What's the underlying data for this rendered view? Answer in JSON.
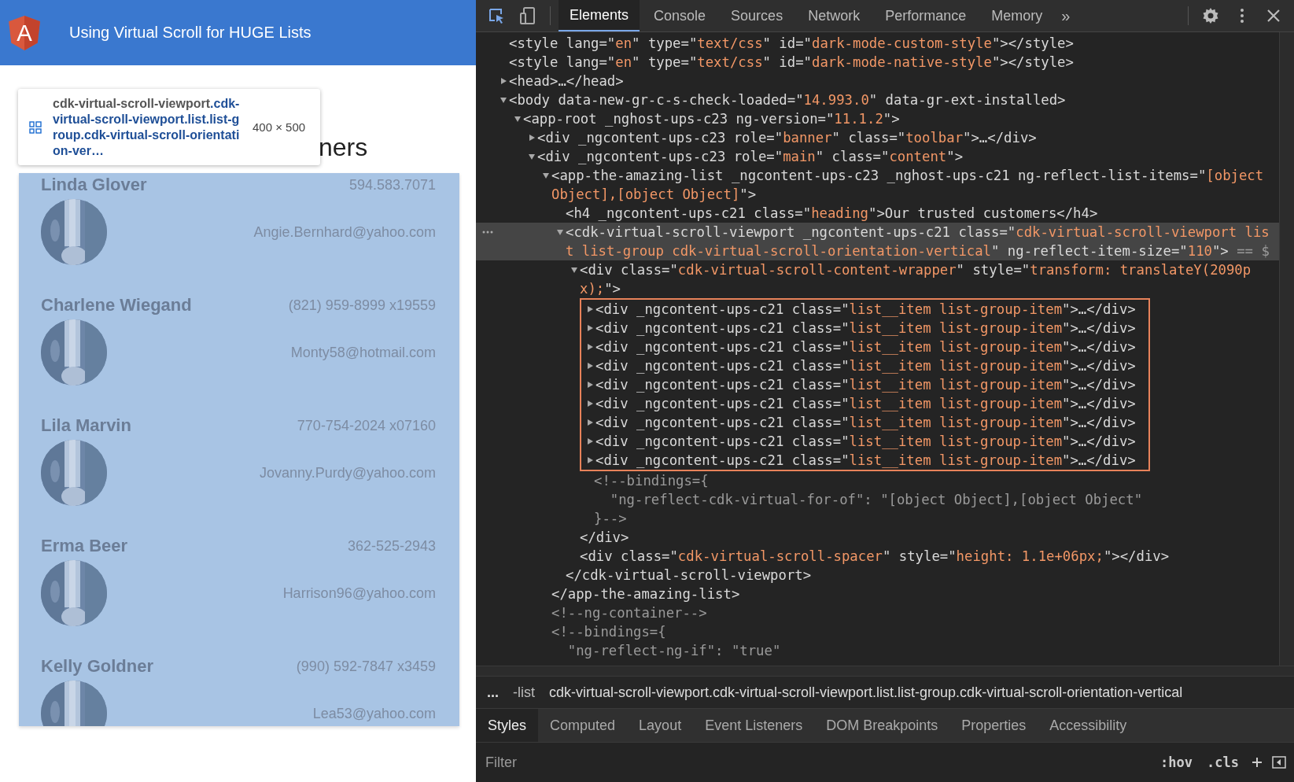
{
  "app": {
    "logo_letter": "A",
    "title": "Using Virtual Scroll for HUGE Lists",
    "heading": "ners",
    "tooltip": {
      "tag": "cdk-virtual-scroll-viewport",
      "classes": ".cdk-virtual-scroll-viewport.list.list-group.cdk-virtual-scroll-orientation-ver…",
      "size": "400 × 500"
    },
    "customers": [
      {
        "name": "Linda Glover",
        "phone": "594.583.7071",
        "email": "Angie.Bernhard@yahoo.com"
      },
      {
        "name": "Charlene Wiegand",
        "phone": "(821) 959-8999 x19559",
        "email": "Monty58@hotmail.com"
      },
      {
        "name": "Lila Marvin",
        "phone": "770-754-2024 x07160",
        "email": "Jovanny.Purdy@yahoo.com"
      },
      {
        "name": "Erma Beer",
        "phone": "362-525-2943",
        "email": "Harrison96@yahoo.com"
      },
      {
        "name": "Kelly Goldner",
        "phone": "(990) 592-7847 x3459",
        "email": "Lea53@yahoo.com"
      }
    ]
  },
  "devtools": {
    "tabs": [
      {
        "label": "Elements",
        "selected": true
      },
      {
        "label": "Console",
        "selected": false
      },
      {
        "label": "Sources",
        "selected": false
      },
      {
        "label": "Network",
        "selected": false
      },
      {
        "label": "Performance",
        "selected": false
      },
      {
        "label": "Memory",
        "selected": false
      }
    ],
    "more_tabs": "»",
    "dom": [
      {
        "kind": "node",
        "selected": false,
        "parts": [
          {
            "kind": "markup",
            "text": "<style lang=\""
          },
          {
            "kind": "value",
            "text": "en"
          },
          {
            "kind": "markup",
            "text": "\" type=\""
          },
          {
            "kind": "value",
            "text": "text/css"
          },
          {
            "kind": "markup",
            "text": "\" id=\""
          },
          {
            "kind": "value",
            "text": "dark-mode-custom-style"
          },
          {
            "kind": "markup",
            "text": "\"></style>"
          }
        ]
      },
      {
        "kind": "node",
        "selected": false,
        "parts": [
          {
            "kind": "markup",
            "text": "<style lang=\""
          },
          {
            "kind": "value",
            "text": "en"
          },
          {
            "kind": "markup",
            "text": "\" type=\""
          },
          {
            "kind": "value",
            "text": "text/css"
          },
          {
            "kind": "markup",
            "text": "\" id=\""
          },
          {
            "kind": "value",
            "text": "dark-mode-native-style"
          },
          {
            "kind": "markup",
            "text": "\"></style>"
          }
        ]
      },
      {
        "kind": "node",
        "selected": false,
        "expanded": false,
        "parts": [
          {
            "kind": "markup",
            "text": "<head>…</head>"
          }
        ]
      },
      {
        "kind": "node",
        "selected": false,
        "expanded": true,
        "parts": [
          {
            "kind": "markup",
            "text": "<body data-new-gr-c-s-check-loaded=\""
          },
          {
            "kind": "value",
            "text": "14.993.0"
          },
          {
            "kind": "markup",
            "text": "\" data-gr-ext-installed>"
          }
        ],
        "children": [
          {
            "kind": "node",
            "selected": false,
            "expanded": true,
            "parts": [
              {
                "kind": "markup",
                "text": "<app-root _nghost-ups-c23 ng-version=\""
              },
              {
                "kind": "value",
                "text": "11.1.2"
              },
              {
                "kind": "markup",
                "text": "\">"
              }
            ],
            "children": [
              {
                "kind": "node",
                "selected": false,
                "expanded": false,
                "parts": [
                  {
                    "kind": "markup",
                    "text": "<div _ngcontent-ups-c23 role=\""
                  },
                  {
                    "kind": "value",
                    "text": "banner"
                  },
                  {
                    "kind": "markup",
                    "text": "\" class=\""
                  },
                  {
                    "kind": "value",
                    "text": "toolbar"
                  },
                  {
                    "kind": "markup",
                    "text": "\">…</div>"
                  }
                ]
              },
              {
                "kind": "node",
                "selected": false,
                "expanded": true,
                "parts": [
                  {
                    "kind": "markup",
                    "text": "<div _ngcontent-ups-c23 role=\""
                  },
                  {
                    "kind": "value",
                    "text": "main"
                  },
                  {
                    "kind": "markup",
                    "text": "\" class=\""
                  },
                  {
                    "kind": "value",
                    "text": "content"
                  },
                  {
                    "kind": "markup",
                    "text": "\">"
                  }
                ],
                "children": [
                  {
                    "kind": "node",
                    "selected": false,
                    "expanded": true,
                    "closing": "</app-the-amazing-list>",
                    "parts": [
                      {
                        "kind": "markup",
                        "text": "<app-the-amazing-list _ngcontent-ups-c23 _nghost-ups-c21 ng-reflect-list-items=\""
                      },
                      {
                        "kind": "value",
                        "text": "[object Object],[object Object]"
                      },
                      {
                        "kind": "markup",
                        "text": "\">"
                      }
                    ],
                    "children": [
                      {
                        "kind": "node",
                        "selected": false,
                        "parts": [
                          {
                            "kind": "markup",
                            "text": "<h4 _ngcontent-ups-c21 class=\""
                          },
                          {
                            "kind": "value",
                            "text": "heading"
                          },
                          {
                            "kind": "markup",
                            "text": "\">Our trusted customers</h4>"
                          }
                        ]
                      },
                      {
                        "kind": "node",
                        "selected": true,
                        "expanded": true,
                        "closing": "</cdk-virtual-scroll-viewport>",
                        "parts": [
                          {
                            "kind": "markup",
                            "text": "<cdk-virtual-scroll-viewport _ngcontent-ups-c21 class=\""
                          },
                          {
                            "kind": "value",
                            "text": "cdk-virtual-scroll-viewport list list-group cdk-virtual-scroll-orientation-vertical"
                          },
                          {
                            "kind": "markup",
                            "text": "\" ng-reflect-item-size=\""
                          },
                          {
                            "kind": "value",
                            "text": "110"
                          },
                          {
                            "kind": "markup",
                            "text": "\">"
                          },
                          {
                            "kind": "marker",
                            "text": " == $"
                          }
                        ],
                        "children": [
                          {
                            "kind": "node",
                            "selected": false,
                            "expanded": true,
                            "closing": "</div>",
                            "parts": [
                              {
                                "kind": "markup",
                                "text": "<div class=\""
                              },
                              {
                                "kind": "value",
                                "text": "cdk-virtual-scroll-content-wrapper"
                              },
                              {
                                "kind": "markup",
                                "text": "\" style=\""
                              },
                              {
                                "kind": "value",
                                "text": "transform: translateY(2090px);"
                              },
                              {
                                "kind": "markup",
                                "text": "\">"
                              }
                            ],
                            "children": [
                              {
                                "kind": "group",
                                "children": [
                                  {
                                    "kind": "node",
                                    "selected": false,
                                    "expanded": false,
                                    "parts": [
                                      {
                                        "kind": "markup",
                                        "text": "<div _ngcontent-ups-c21 class=\""
                                      },
                                      {
                                        "kind": "value",
                                        "text": "list__item list-group-item"
                                      },
                                      {
                                        "kind": "markup",
                                        "text": "\">…</div>"
                                      }
                                    ]
                                  },
                                  {
                                    "kind": "node",
                                    "selected": false,
                                    "expanded": false,
                                    "parts": [
                                      {
                                        "kind": "markup",
                                        "text": "<div _ngcontent-ups-c21 class=\""
                                      },
                                      {
                                        "kind": "value",
                                        "text": "list__item list-group-item"
                                      },
                                      {
                                        "kind": "markup",
                                        "text": "\">…</div>"
                                      }
                                    ]
                                  },
                                  {
                                    "kind": "node",
                                    "selected": false,
                                    "expanded": false,
                                    "parts": [
                                      {
                                        "kind": "markup",
                                        "text": "<div _ngcontent-ups-c21 class=\""
                                      },
                                      {
                                        "kind": "value",
                                        "text": "list__item list-group-item"
                                      },
                                      {
                                        "kind": "markup",
                                        "text": "\">…</div>"
                                      }
                                    ]
                                  },
                                  {
                                    "kind": "node",
                                    "selected": false,
                                    "expanded": false,
                                    "parts": [
                                      {
                                        "kind": "markup",
                                        "text": "<div _ngcontent-ups-c21 class=\""
                                      },
                                      {
                                        "kind": "value",
                                        "text": "list__item list-group-item"
                                      },
                                      {
                                        "kind": "markup",
                                        "text": "\">…</div>"
                                      }
                                    ]
                                  },
                                  {
                                    "kind": "node",
                                    "selected": false,
                                    "expanded": false,
                                    "parts": [
                                      {
                                        "kind": "markup",
                                        "text": "<div _ngcontent-ups-c21 class=\""
                                      },
                                      {
                                        "kind": "value",
                                        "text": "list__item list-group-item"
                                      },
                                      {
                                        "kind": "markup",
                                        "text": "\">…</div>"
                                      }
                                    ]
                                  },
                                  {
                                    "kind": "node",
                                    "selected": false,
                                    "expanded": false,
                                    "parts": [
                                      {
                                        "kind": "markup",
                                        "text": "<div _ngcontent-ups-c21 class=\""
                                      },
                                      {
                                        "kind": "value",
                                        "text": "list__item list-group-item"
                                      },
                                      {
                                        "kind": "markup",
                                        "text": "\">…</div>"
                                      }
                                    ]
                                  },
                                  {
                                    "kind": "node",
                                    "selected": false,
                                    "expanded": false,
                                    "parts": [
                                      {
                                        "kind": "markup",
                                        "text": "<div _ngcontent-ups-c21 class=\""
                                      },
                                      {
                                        "kind": "value",
                                        "text": "list__item list-group-item"
                                      },
                                      {
                                        "kind": "markup",
                                        "text": "\">…</div>"
                                      }
                                    ]
                                  },
                                  {
                                    "kind": "node",
                                    "selected": false,
                                    "expanded": false,
                                    "parts": [
                                      {
                                        "kind": "markup",
                                        "text": "<div _ngcontent-ups-c21 class=\""
                                      },
                                      {
                                        "kind": "value",
                                        "text": "list__item list-group-item"
                                      },
                                      {
                                        "kind": "markup",
                                        "text": "\">…</div>"
                                      }
                                    ]
                                  },
                                  {
                                    "kind": "node",
                                    "selected": false,
                                    "expanded": false,
                                    "parts": [
                                      {
                                        "kind": "markup",
                                        "text": "<div _ngcontent-ups-c21 class=\""
                                      },
                                      {
                                        "kind": "value",
                                        "text": "list__item list-group-item"
                                      },
                                      {
                                        "kind": "markup",
                                        "text": "\">…</div>"
                                      }
                                    ]
                                  }
                                ]
                              },
                              {
                                "kind": "node",
                                "selected": false,
                                "parts": [
                                  {
                                    "kind": "comment",
                                    "text": "<!--bindings={\n  \"ng-reflect-cdk-virtual-for-of\": \"[object Object],[object Object\"\n}-->"
                                  }
                                ]
                              }
                            ]
                          },
                          {
                            "kind": "node",
                            "selected": false,
                            "parts": [
                              {
                                "kind": "markup",
                                "text": "<div class=\""
                              },
                              {
                                "kind": "value",
                                "text": "cdk-virtual-scroll-spacer"
                              },
                              {
                                "kind": "markup",
                                "text": "\" style=\""
                              },
                              {
                                "kind": "value",
                                "text": "height: 1.1e+06px;"
                              },
                              {
                                "kind": "markup",
                                "text": "\"></div>"
                              }
                            ]
                          }
                        ]
                      }
                    ]
                  },
                  {
                    "kind": "node",
                    "selected": false,
                    "parts": [
                      {
                        "kind": "comment",
                        "text": "<!--ng-container-->"
                      }
                    ]
                  },
                  {
                    "kind": "node",
                    "selected": false,
                    "parts": [
                      {
                        "kind": "comment",
                        "text": "<!--bindings={\n  \"ng-reflect-ng-if\": \"true\""
                      }
                    ]
                  }
                ]
              }
            ]
          }
        ]
      }
    ],
    "breadcrumbs": {
      "overflow": "...",
      "items": [
        {
          "label": "-list",
          "selected": false
        },
        {
          "label": "cdk-virtual-scroll-viewport.cdk-virtual-scroll-viewport.list.list-group.cdk-virtual-scroll-orientation-vertical",
          "selected": true
        }
      ]
    },
    "panel_tabs": [
      {
        "label": "Styles",
        "selected": true
      },
      {
        "label": "Computed",
        "selected": false
      },
      {
        "label": "Layout",
        "selected": false
      },
      {
        "label": "Event Listeners",
        "selected": false
      },
      {
        "label": "DOM Breakpoints",
        "selected": false
      },
      {
        "label": "Properties",
        "selected": false
      },
      {
        "label": "Accessibility",
        "selected": false
      }
    ],
    "filter": {
      "placeholder": "Filter"
    },
    "filter_buttons": [
      ":hov",
      ".cls"
    ]
  }
}
